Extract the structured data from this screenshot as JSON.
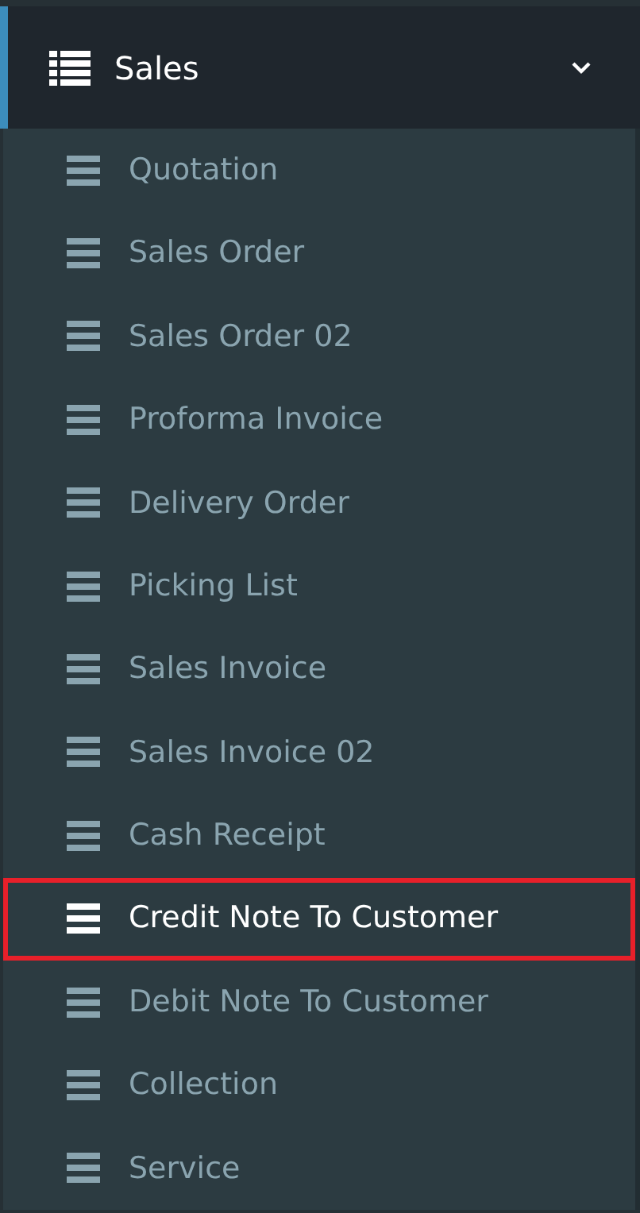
{
  "menu": {
    "title": "Sales",
    "expanded": true,
    "items": [
      {
        "label": "Quotation",
        "selected": false
      },
      {
        "label": "Sales Order",
        "selected": false
      },
      {
        "label": "Sales Order 02",
        "selected": false
      },
      {
        "label": "Proforma Invoice",
        "selected": false
      },
      {
        "label": "Delivery Order",
        "selected": false
      },
      {
        "label": "Picking List",
        "selected": false
      },
      {
        "label": "Sales Invoice",
        "selected": false
      },
      {
        "label": "Sales Invoice 02",
        "selected": false
      },
      {
        "label": "Cash Receipt",
        "selected": false
      },
      {
        "label": "Credit Note To Customer",
        "selected": true
      },
      {
        "label": "Debit Note To Customer",
        "selected": false
      },
      {
        "label": "Collection",
        "selected": false
      },
      {
        "label": "Service",
        "selected": false
      }
    ]
  }
}
